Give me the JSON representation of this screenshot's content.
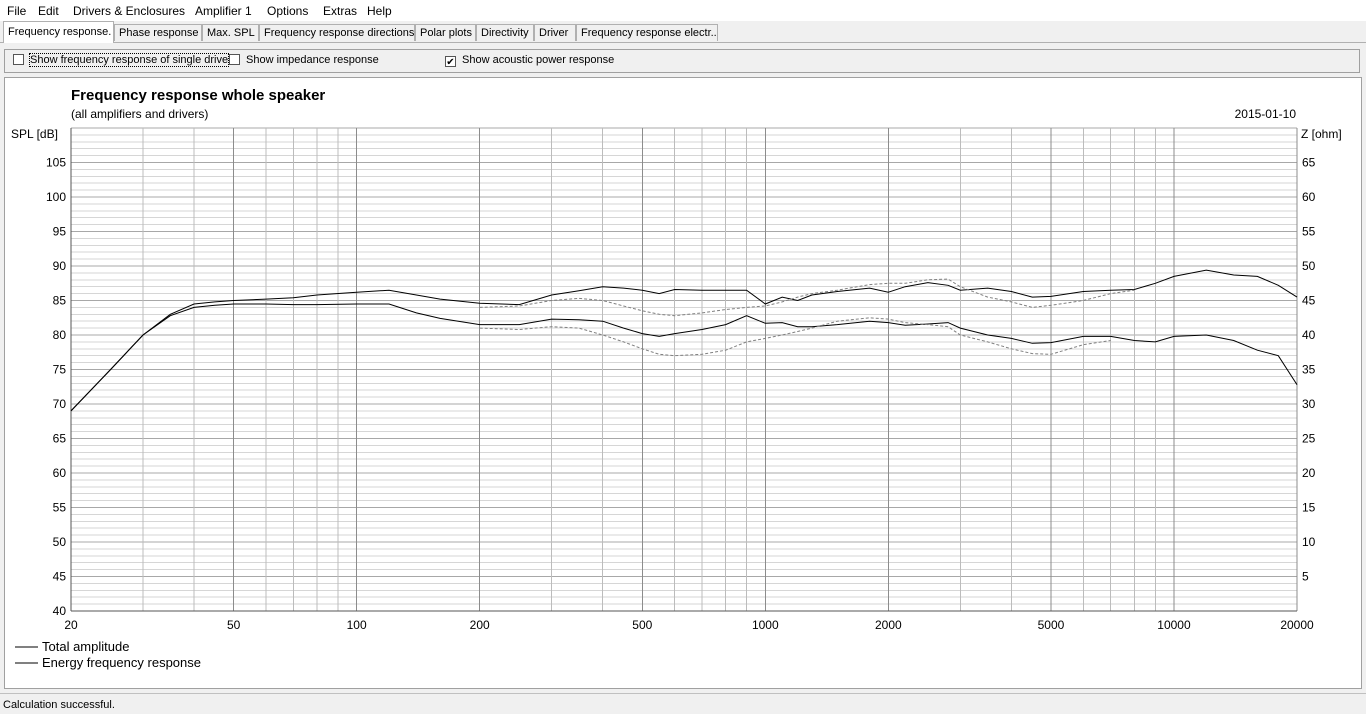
{
  "menu": [
    "File",
    "Edit",
    "Drivers & Enclosures",
    "Amplifier 1",
    "Options",
    "Extras",
    "Help"
  ],
  "tabs": [
    {
      "label": "Frequency response.",
      "active": true
    },
    {
      "label": "Phase response",
      "active": false
    },
    {
      "label": "Max. SPL",
      "active": false
    },
    {
      "label": "Frequency response directions",
      "active": false
    },
    {
      "label": "Polar plots",
      "active": false
    },
    {
      "label": "Directivity",
      "active": false
    },
    {
      "label": "Driver",
      "active": false
    },
    {
      "label": "Frequency response electr..",
      "active": false
    }
  ],
  "options": [
    {
      "label": "Show frequency response of single drive",
      "checked": false
    },
    {
      "label": "Show impedance response",
      "checked": false
    },
    {
      "label": "Show acoustic power response",
      "checked": true
    }
  ],
  "status": "Calculation successful.",
  "chart_data": {
    "type": "line",
    "title": "Frequency response whole speaker",
    "subtitle": "(all amplifiers and drivers)",
    "date": "2015-01-10",
    "ylabel": "SPL [dB]",
    "y2label": "Z [ohm]",
    "xscale": "log",
    "xlim": [
      20,
      20000
    ],
    "ylim": [
      40,
      110
    ],
    "y2lim": [
      0,
      70
    ],
    "x_ticks": [
      20,
      50,
      100,
      200,
      500,
      1000,
      2000,
      5000,
      10000,
      20000
    ],
    "y_ticks": [
      40,
      45,
      50,
      55,
      60,
      65,
      70,
      75,
      80,
      85,
      90,
      95,
      100,
      105
    ],
    "y2_ticks": [
      5,
      10,
      15,
      20,
      25,
      30,
      35,
      40,
      45,
      50,
      55,
      60,
      65
    ],
    "legend": [
      "Total amplitude",
      "Energy frequency response"
    ],
    "line_color": "#000000",
    "dashed_color": "#808080",
    "series": [
      {
        "name": "Total amplitude",
        "style": "solid",
        "x": [
          20,
          25,
          30,
          35,
          40,
          45,
          50,
          60,
          70,
          80,
          100,
          120,
          140,
          160,
          200,
          250,
          300,
          350,
          400,
          450,
          500,
          550,
          600,
          700,
          800,
          900,
          1000,
          1100,
          1200,
          1300,
          1500,
          1800,
          2000,
          2200,
          2500,
          2800,
          3000,
          3500,
          4000,
          4500,
          5000,
          6000,
          7000,
          8000,
          9000,
          10000,
          12000,
          14000,
          16000,
          18000,
          20000
        ],
        "y": [
          69,
          75,
          80,
          83,
          84.5,
          84.8,
          85,
          85.2,
          85.4,
          85.8,
          86.2,
          86.5,
          85.8,
          85.2,
          84.6,
          84.4,
          85.8,
          86.4,
          87,
          86.8,
          86.5,
          86,
          86.6,
          86.5,
          86.5,
          86.5,
          84.5,
          85.5,
          85,
          85.8,
          86.3,
          86.8,
          86.2,
          87,
          87.6,
          87.2,
          86.5,
          86.8,
          86.3,
          85.5,
          85.6,
          86.3,
          86.5,
          86.6,
          87.5,
          88.5,
          89.4,
          88.7,
          88.5,
          87.2,
          85.5
        ]
      },
      {
        "name": "Energy frequency response",
        "style": "solid",
        "x": [
          20,
          25,
          30,
          35,
          40,
          45,
          50,
          60,
          70,
          80,
          100,
          120,
          140,
          160,
          200,
          250,
          300,
          350,
          400,
          450,
          500,
          550,
          600,
          700,
          800,
          900,
          1000,
          1100,
          1200,
          1300,
          1500,
          1800,
          2000,
          2200,
          2500,
          2800,
          3000,
          3500,
          4000,
          4500,
          5000,
          6000,
          7000,
          8000,
          9000,
          10000,
          12000,
          14000,
          16000,
          18000,
          20000
        ],
        "y": [
          69,
          75,
          80,
          82.8,
          84,
          84.3,
          84.5,
          84.5,
          84.4,
          84.4,
          84.5,
          84.5,
          83.2,
          82.4,
          81.5,
          81.5,
          82.3,
          82.2,
          82,
          81,
          80.2,
          79.8,
          80.2,
          80.8,
          81.5,
          82.8,
          81.7,
          81.8,
          81.2,
          81.2,
          81.5,
          82,
          81.8,
          81.4,
          81.6,
          81.8,
          81,
          80,
          79.5,
          78.8,
          78.9,
          79.8,
          79.8,
          79.2,
          79,
          79.8,
          80,
          79.2,
          77.8,
          77,
          72.8
        ]
      },
      {
        "name": "",
        "style": "dashed",
        "x": [
          200,
          250,
          300,
          350,
          400,
          450,
          500,
          550,
          600,
          700,
          800,
          900,
          1000,
          1100,
          1200,
          1300,
          1500,
          1800,
          2000,
          2200,
          2500,
          2800,
          3000,
          3500,
          4000,
          4500,
          5000,
          6000,
          7000,
          8000
        ],
        "y": [
          84,
          84.2,
          85,
          85.3,
          85,
          84.2,
          83.5,
          83,
          82.8,
          83.2,
          83.7,
          84,
          84.2,
          84.8,
          85.5,
          86,
          86.5,
          87.3,
          87.5,
          87.5,
          88,
          88.1,
          87,
          85.5,
          84.8,
          84,
          84.3,
          85,
          86,
          86.5
        ]
      },
      {
        "name": "",
        "style": "dashed",
        "x": [
          200,
          250,
          300,
          350,
          400,
          450,
          500,
          550,
          600,
          700,
          800,
          900,
          1000,
          1100,
          1200,
          1300,
          1500,
          1800,
          2000,
          2200,
          2500,
          2800,
          3000,
          3500,
          4000,
          4500,
          5000,
          6000,
          7000
        ],
        "y": [
          81,
          80.8,
          81.2,
          81,
          80,
          79,
          78,
          77.2,
          77,
          77.2,
          77.8,
          79,
          79.5,
          80,
          80.5,
          81,
          82,
          82.5,
          82.3,
          81.8,
          81.5,
          81.2,
          80,
          79,
          78,
          77.3,
          77.2,
          78.6,
          79.2
        ]
      }
    ]
  }
}
